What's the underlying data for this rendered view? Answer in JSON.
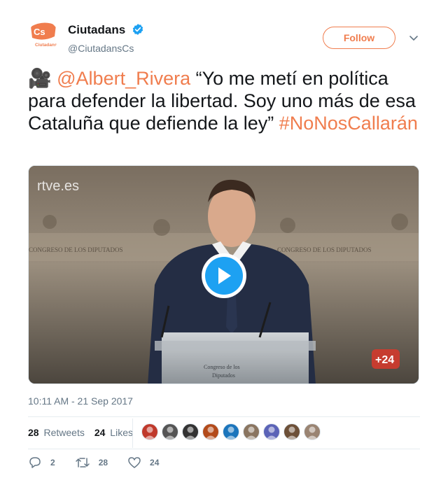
{
  "user": {
    "display_name": "Ciutadans",
    "handle": "@CiutadansCs",
    "avatar_logo_text": "Cs",
    "avatar_logo_subtext": "Ciutadans"
  },
  "follow_label": "Follow",
  "tweet": {
    "emoji": "🎥",
    "mention": "@Albert_Rivera",
    "body": " “Yo me metí en política para defender la libertad. Soy uno más de esa Cataluña que defiende la ley” ",
    "hashtag": "#NoNosCallarán"
  },
  "media": {
    "watermark": "rtve.es",
    "channel_badge": "+24",
    "podium_text_1": "Congreso de los",
    "podium_text_2": "Diputados",
    "wall_text": "CONGRESO DE LOS DIPUTADOS"
  },
  "timestamp": "10:11 AM - 21 Sep 2017",
  "stats": {
    "retweets_count": "28",
    "retweets_label": "Retweets",
    "likes_count": "24",
    "likes_label": "Likes"
  },
  "likers": [
    {
      "icon": "avatar-1",
      "color": "#c0392b"
    },
    {
      "icon": "avatar-2",
      "color": "#555555"
    },
    {
      "icon": "avatar-3",
      "color": "#333333"
    },
    {
      "icon": "avatar-4",
      "color": "#b34a1a"
    },
    {
      "icon": "avatar-5",
      "color": "#1b75bc"
    },
    {
      "icon": "avatar-6",
      "color": "#8a7560"
    },
    {
      "icon": "avatar-7",
      "color": "#5b63b7"
    },
    {
      "icon": "avatar-8",
      "color": "#6d5038"
    },
    {
      "icon": "avatar-9",
      "color": "#9a8472"
    }
  ],
  "actions": {
    "reply_count": "2",
    "retweet_count": "28",
    "like_count": "24"
  },
  "colors": {
    "accent": "#f07d4e",
    "verified": "#1da1f2",
    "play": "#1da1f2"
  }
}
